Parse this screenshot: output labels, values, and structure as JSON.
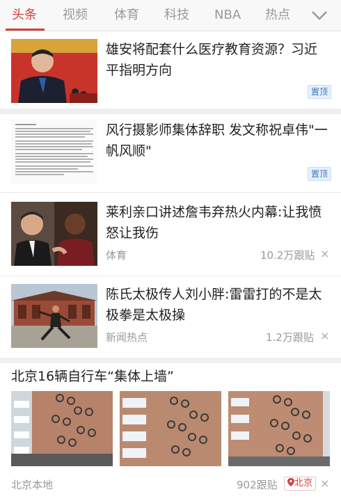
{
  "tabs": [
    {
      "label": "头条",
      "active": true
    },
    {
      "label": "视频",
      "active": false
    },
    {
      "label": "体育",
      "active": false
    },
    {
      "label": "科技",
      "active": false
    },
    {
      "label": "NBA",
      "active": false
    },
    {
      "label": "热点",
      "active": false
    }
  ],
  "more_icon": "chevron-down-icon",
  "articles": [
    {
      "title": "雄安将配套什么医疗教育资源？习近平指明方向",
      "badge": "置顶"
    },
    {
      "title": "风行摄影师集体辞职 发文称祝卓伟\"一帆风顺\"",
      "badge": "置顶"
    },
    {
      "title": "莱利亲口讲述詹韦弃热火内幕:让我愤怒让我伤",
      "source": "体育",
      "comments": "10.2万跟贴"
    },
    {
      "title": "陈氏太极传人刘小胖:雷雷打的不是太极拳是太极操",
      "source": "新闻热点",
      "comments": "1.2万跟贴"
    }
  ],
  "gallery": {
    "title": "北京16辆自行车“集体上墙”",
    "source": "北京本地",
    "comments": "902跟贴",
    "location": "北京",
    "location_icon": "location-pin-icon"
  },
  "close_symbol": "×",
  "colors": {
    "accent": "#d43d3d",
    "badge_blue": "#3a77c6"
  }
}
